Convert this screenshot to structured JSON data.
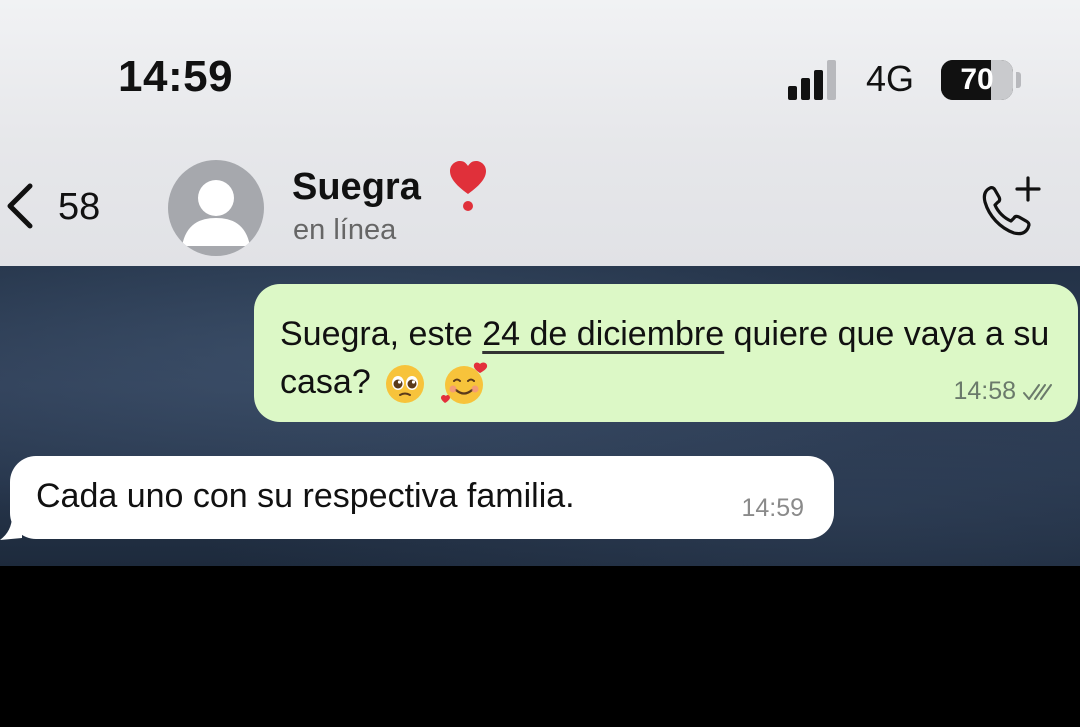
{
  "status_bar": {
    "time": "14:59",
    "network": "4G",
    "battery_percent": "70",
    "signal_bars_active": 3,
    "signal_bars_total": 4
  },
  "chat_header": {
    "back_count": "58",
    "contact_name": "Suegra",
    "contact_status": "en línea",
    "icons": [
      "back-chevron-icon",
      "avatar-placeholder-icon",
      "heart-exclamation-icon",
      "add-call-icon"
    ]
  },
  "messages": [
    {
      "direction": "outgoing",
      "text_before": "Suegra, este ",
      "link_text": "24 de diciembre",
      "text_after": " quiere que vaya a su casa?",
      "emojis": [
        "pleading-face-emoji",
        "smiling-face-with-hearts-emoji"
      ],
      "time": "14:58",
      "status": "read-double-check"
    },
    {
      "direction": "incoming",
      "text": "Cada uno con su respectiva familia.",
      "time": "14:59"
    }
  ],
  "colors": {
    "outgoing_bubble": "#dcf8c6",
    "incoming_bubble": "#ffffff",
    "header_bg": "#e6e7ea",
    "chat_bg": "#2a3950"
  }
}
